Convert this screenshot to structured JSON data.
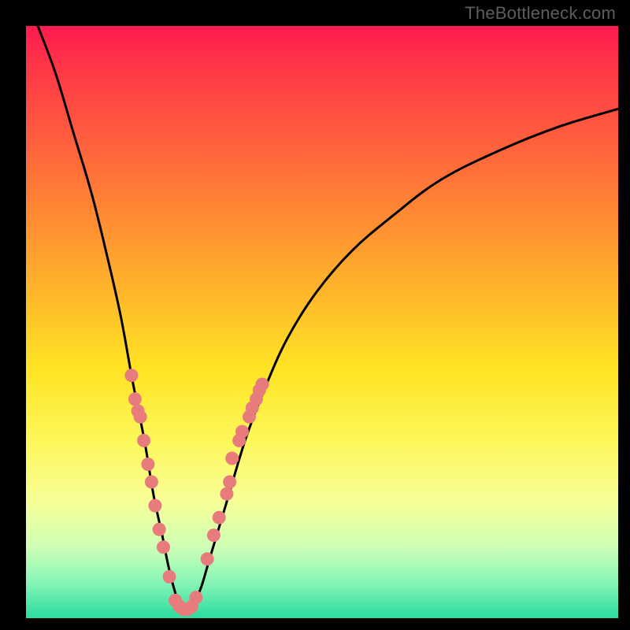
{
  "watermark": "TheBottleneck.com",
  "chart_data": {
    "type": "line",
    "title": "",
    "xlabel": "",
    "ylabel": "",
    "xlim": [
      0,
      100
    ],
    "ylim": [
      0,
      100
    ],
    "series": [
      {
        "name": "bottleneck-curve",
        "x": [
          2,
          5,
          8,
          11,
          13.5,
          16,
          18,
          20,
          21.5,
          23,
          24,
          25,
          26,
          27,
          28,
          29.5,
          31,
          34,
          37,
          40,
          44,
          49,
          55,
          62,
          70,
          80,
          90,
          100
        ],
        "y": [
          100,
          92,
          82,
          72,
          62,
          51,
          40,
          30,
          21,
          14,
          9,
          5,
          2,
          1,
          2,
          5,
          10,
          20,
          30,
          38,
          47,
          55,
          62,
          68,
          74,
          79,
          83,
          86
        ]
      }
    ],
    "markers": {
      "name": "highlight-dots",
      "color": "#e87b7b",
      "points": [
        {
          "x": 17.8,
          "y": 41
        },
        {
          "x": 18.4,
          "y": 37
        },
        {
          "x": 18.9,
          "y": 35
        },
        {
          "x": 19.3,
          "y": 34
        },
        {
          "x": 19.9,
          "y": 30
        },
        {
          "x": 20.6,
          "y": 26
        },
        {
          "x": 21.2,
          "y": 23
        },
        {
          "x": 21.8,
          "y": 19
        },
        {
          "x": 22.5,
          "y": 15
        },
        {
          "x": 23.2,
          "y": 12
        },
        {
          "x": 24.2,
          "y": 7
        },
        {
          "x": 25.2,
          "y": 3
        },
        {
          "x": 25.9,
          "y": 2
        },
        {
          "x": 26.6,
          "y": 1.5
        },
        {
          "x": 27.3,
          "y": 1.5
        },
        {
          "x": 28.0,
          "y": 2
        },
        {
          "x": 28.7,
          "y": 3.5
        },
        {
          "x": 30.6,
          "y": 10
        },
        {
          "x": 31.7,
          "y": 14
        },
        {
          "x": 32.6,
          "y": 17
        },
        {
          "x": 33.9,
          "y": 21
        },
        {
          "x": 34.4,
          "y": 23
        },
        {
          "x": 34.8,
          "y": 27
        },
        {
          "x": 36.0,
          "y": 30
        },
        {
          "x": 36.5,
          "y": 31.5
        },
        {
          "x": 37.7,
          "y": 34
        },
        {
          "x": 38.2,
          "y": 35.5
        },
        {
          "x": 38.9,
          "y": 37
        },
        {
          "x": 39.4,
          "y": 38.5
        },
        {
          "x": 39.9,
          "y": 39.5
        }
      ]
    },
    "gradient_stops": [
      {
        "pos": 0.0,
        "color": "#ff1a4f"
      },
      {
        "pos": 0.06,
        "color": "#ff3348"
      },
      {
        "pos": 0.18,
        "color": "#ff5a3e"
      },
      {
        "pos": 0.32,
        "color": "#ff8a33"
      },
      {
        "pos": 0.46,
        "color": "#ffba2a"
      },
      {
        "pos": 0.58,
        "color": "#ffe424"
      },
      {
        "pos": 0.7,
        "color": "#fdf75a"
      },
      {
        "pos": 0.8,
        "color": "#f8ff95"
      },
      {
        "pos": 0.88,
        "color": "#ceffb6"
      },
      {
        "pos": 0.94,
        "color": "#86f5b6"
      },
      {
        "pos": 1.0,
        "color": "#2bdc9f"
      }
    ]
  }
}
